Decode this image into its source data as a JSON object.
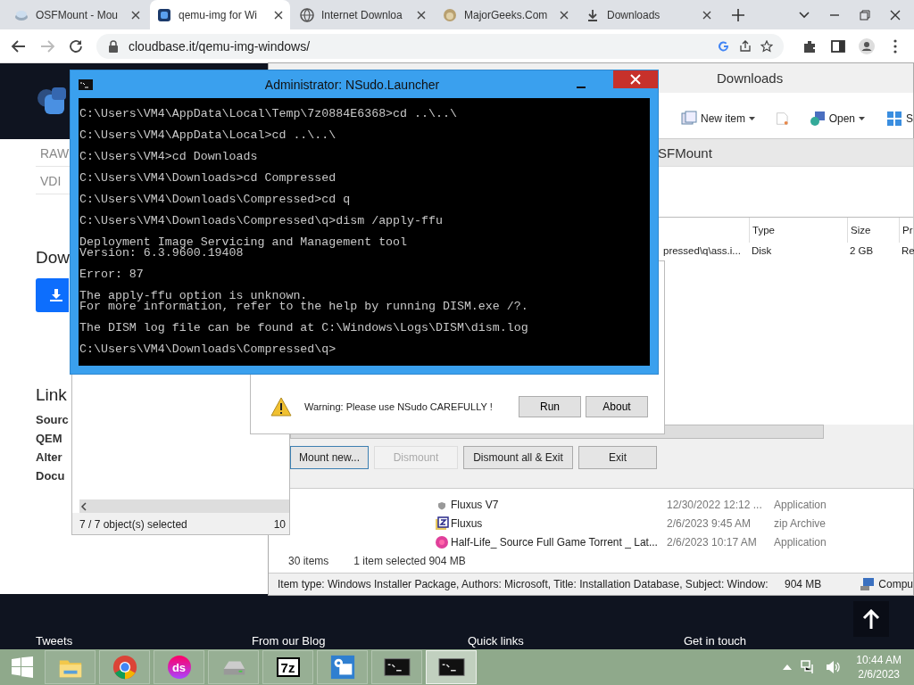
{
  "browser": {
    "tabs": [
      {
        "label": "OSFMount - Mou",
        "selected": false
      },
      {
        "label": "qemu-img for Wi",
        "selected": true
      },
      {
        "label": "Internet Downloa",
        "selected": false
      },
      {
        "label": "MajorGeeks.Com",
        "selected": false
      },
      {
        "label": "Downloads",
        "selected": false
      }
    ],
    "address": "cloudbase.it/qemu-img-windows/"
  },
  "page": {
    "formats": [
      "RAW",
      "VDI"
    ],
    "download_heading": "Dow",
    "links_heading": "Link",
    "links": [
      "Sourc",
      "QEM",
      "Alter",
      "Docu"
    ],
    "footer_headings": [
      "Tweets",
      "From our Blog",
      "Quick links",
      "Get in touch"
    ]
  },
  "explorer": {
    "title": "Downloads",
    "ribbon": [
      {
        "label": "New item",
        "kind": "new"
      },
      {
        "label": "Open",
        "kind": "open"
      },
      {
        "label": "S",
        "kind": "select"
      }
    ],
    "files": [
      {
        "name": "Fluxus V7",
        "date": "12/30/2022 12:12 ...",
        "type": "Application",
        "kind": "shield"
      },
      {
        "name": "Fluxus",
        "date": "2/6/2023 9:45 AM",
        "type": "zip Archive",
        "kind": "zip"
      },
      {
        "name": "Half-Life_ Source Full Game Torrent _ Lat...",
        "date": "2/6/2023 10:17 AM",
        "type": "Application",
        "kind": "ds"
      }
    ],
    "item_count": "30 items",
    "selection": "1 item selected  904 MB",
    "details": "Item type: Windows Installer Package, Authors: Microsoft, Title: Installation Database, Subject: Window:",
    "details_size": "904 MB",
    "location": "Compu"
  },
  "osfmount": {
    "title": "SFMount",
    "columns": [
      "",
      "Type",
      "Size",
      "Pr"
    ],
    "rows": [
      [
        "pressed\\q\\ass.i...",
        "Disk",
        "2 GB",
        "Re"
      ]
    ],
    "buttons": [
      {
        "label": "Mount new...",
        "disabled": false
      },
      {
        "label": "Dismount",
        "disabled": true
      },
      {
        "label": "Dismount all & Exit",
        "disabled": false
      },
      {
        "label": "Exit",
        "disabled": false
      }
    ]
  },
  "archive_window": {
    "status": "7 / 7 object(s) selected",
    "status_size": "10"
  },
  "nsudo": {
    "title": "Administrator: NSudo.Launcher",
    "console": [
      [
        "C:\\Users\\VM4\\AppData\\Local\\Temp\\7z0884E6368>cd ..\\..\\"
      ],
      [
        "C:\\Users\\VM4\\AppData\\Local>cd ..\\..\\"
      ],
      [
        "C:\\Users\\VM4>cd Downloads"
      ],
      [
        "C:\\Users\\VM4\\Downloads>cd Compressed"
      ],
      [
        "C:\\Users\\VM4\\Downloads\\Compressed>cd q"
      ],
      [
        "C:\\Users\\VM4\\Downloads\\Compressed\\q>dism /apply-ffu"
      ],
      [
        "Deployment Image Servicing and Management tool",
        "Version: 6.3.9600.19408"
      ],
      [
        "Error: 87"
      ],
      [
        "The apply-ffu option is unknown.",
        "For more information, refer to the help by running DISM.exe /?."
      ],
      [
        "The DISM log file can be found at C:\\Windows\\Logs\\DISM\\dism.log"
      ],
      [
        "C:\\Users\\VM4\\Downloads\\Compressed\\q>"
      ]
    ],
    "warning": "Warning: Please use NSudo CAREFULLY !",
    "buttons": [
      "Run",
      "About"
    ]
  },
  "taskbar": {
    "apps": [
      {
        "kind": "folder",
        "selected": false
      },
      {
        "kind": "chrome",
        "selected": false
      },
      {
        "kind": "ds",
        "label": "ds",
        "selected": false
      },
      {
        "kind": "drive",
        "selected": false
      },
      {
        "kind": "sevenzip",
        "label": "7z",
        "selected": false
      },
      {
        "kind": "settings",
        "selected": false
      },
      {
        "kind": "cmd",
        "selected": false
      },
      {
        "kind": "cmd",
        "selected": true
      }
    ],
    "time": "10:44 AM",
    "date": "2/6/2023"
  }
}
